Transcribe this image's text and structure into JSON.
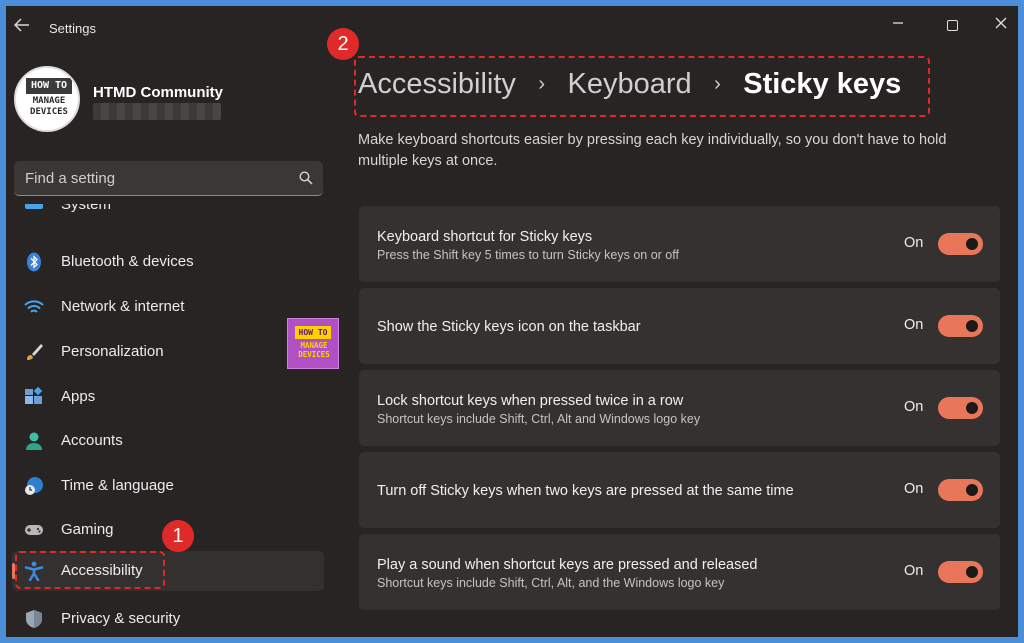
{
  "window": {
    "title": "Settings"
  },
  "colors": {
    "accent": "#e8765a",
    "annotation": "#e02a2a",
    "background": "#272423"
  },
  "profile": {
    "name": "HTMD Community",
    "logo_top": "HOW TO",
    "logo_bottom": [
      "MANAGE",
      "DEVICES"
    ]
  },
  "search": {
    "placeholder": "Find a setting",
    "icon": "search-icon"
  },
  "sidebar": {
    "items": [
      {
        "label": "System",
        "icon": "monitor-icon"
      },
      {
        "label": "Bluetooth & devices",
        "icon": "bluetooth-icon"
      },
      {
        "label": "Network & internet",
        "icon": "wifi-icon"
      },
      {
        "label": "Personalization",
        "icon": "brush-icon"
      },
      {
        "label": "Apps",
        "icon": "apps-icon"
      },
      {
        "label": "Accounts",
        "icon": "person-icon"
      },
      {
        "label": "Time & language",
        "icon": "globe-clock-icon"
      },
      {
        "label": "Gaming",
        "icon": "gamepad-icon"
      },
      {
        "label": "Accessibility",
        "icon": "accessibility-icon",
        "selected": true
      },
      {
        "label": "Privacy & security",
        "icon": "shield-icon"
      }
    ]
  },
  "watermark": {
    "top": "HOW TO",
    "bottom": [
      "MANAGE",
      "DEVICES"
    ]
  },
  "annotations": {
    "step1": "1",
    "step2": "2"
  },
  "breadcrumb": {
    "items": [
      "Accessibility",
      "Keyboard"
    ],
    "current": "Sticky keys",
    "separator": "›"
  },
  "description": "Make keyboard shortcuts easier by pressing each key individually, so you don't have to hold multiple keys at once.",
  "settings": [
    {
      "title": "Keyboard shortcut for Sticky keys",
      "subtitle": "Press the Shift key 5 times to turn Sticky keys on or off",
      "state": "On"
    },
    {
      "title": "Show the Sticky keys icon on the taskbar",
      "subtitle": "",
      "state": "On"
    },
    {
      "title": "Lock shortcut keys when pressed twice in a row",
      "subtitle": "Shortcut keys include Shift, Ctrl, Alt and Windows logo key",
      "state": "On"
    },
    {
      "title": "Turn off Sticky keys when two keys are pressed at the same time",
      "subtitle": "",
      "state": "On"
    },
    {
      "title": "Play a sound when shortcut keys are pressed and released",
      "subtitle": "Shortcut keys include Shift, Ctrl, Alt, and the Windows logo key",
      "state": "On"
    }
  ]
}
